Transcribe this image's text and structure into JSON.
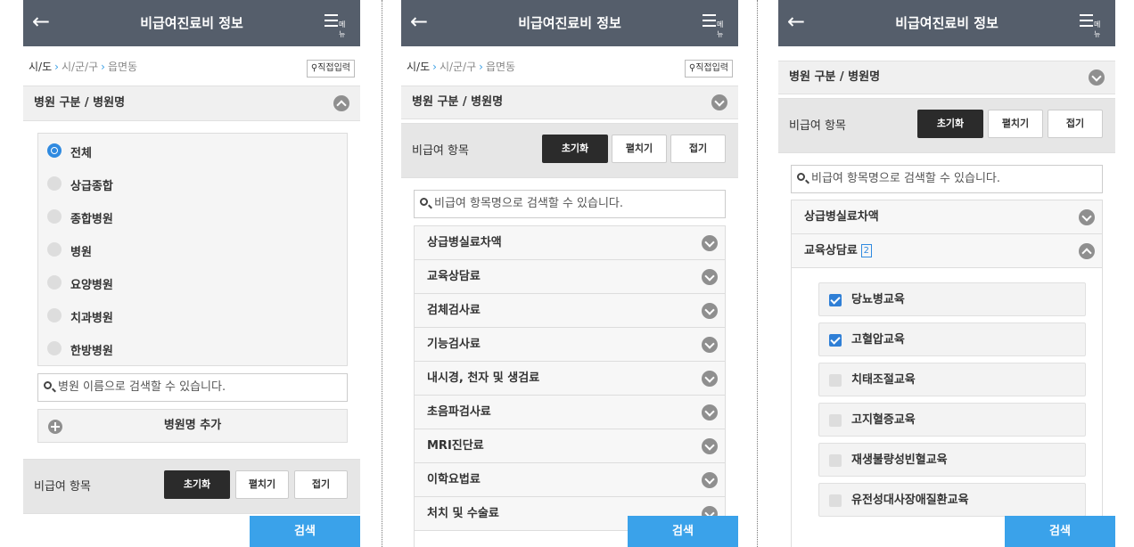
{
  "header": {
    "title": "비급여진료비 정보",
    "back_icon": "←",
    "menu_label": "메뉴"
  },
  "breadcrumb": {
    "sido": "시/도",
    "sigungu": "시/군/구",
    "eupmyeondong": "읍면동",
    "direct_input": "직접입력"
  },
  "hospital_section": {
    "label": "병원 구분 / 병원명"
  },
  "hospital_types": [
    "전체",
    "상급종합",
    "종합병원",
    "병원",
    "요양병원",
    "치과병원",
    "한방병원"
  ],
  "hospital_search": {
    "placeholder": "병원 이름으로 검색할 수 있습니다."
  },
  "add_hospital": {
    "label": "병원명 추가"
  },
  "nonbenefit": {
    "label": "비급여 항목",
    "reset": "초기화",
    "expand": "펼치기",
    "collapse": "접기",
    "search_placeholder": "비급여 항목명으로 검색할 수 있습니다.",
    "categories": [
      "상급병실료차액",
      "교육상담료",
      "검체검사료",
      "기능검사료",
      "내시경, 천자 및 생검료",
      "초음파검사료",
      "MRI진단료",
      "이학요법료",
      "처치 및 수술료"
    ],
    "open_category": {
      "name": "교육상담료",
      "count": "2"
    },
    "education_items": [
      {
        "label": "당뇨병교육",
        "checked": true
      },
      {
        "label": "고혈압교육",
        "checked": true
      },
      {
        "label": "치태조절교육",
        "checked": false
      },
      {
        "label": "고지혈증교육",
        "checked": false
      },
      {
        "label": "재생불량성빈혈교육",
        "checked": false
      },
      {
        "label": "유전성대사장애질환교육",
        "checked": false
      }
    ]
  },
  "search_button": "검색",
  "colors": {
    "header": "#555e6b",
    "accent": "#3aa2ea",
    "selected_radio": "#2f8ae0"
  }
}
